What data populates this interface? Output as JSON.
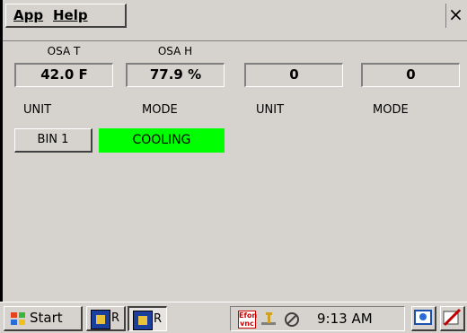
{
  "menu": {
    "app": "App",
    "help": "Help",
    "close": "×"
  },
  "headers": [
    "OSA T",
    "OSA H"
  ],
  "values": [
    "42.0 F",
    "77.9 %",
    "0",
    "0"
  ],
  "labels": [
    "UNIT",
    "MODE",
    "UNIT",
    "MODE"
  ],
  "unit_button": "BIN 1",
  "mode_status": "COOLING",
  "colors": {
    "mode_status_bg": "#00ff00",
    "window_bg": "#d6d3ce"
  },
  "taskbar": {
    "start": "Start",
    "tasks": [
      "R",
      "R"
    ],
    "vnc_icon_text": "Efon vnc",
    "clock": "9:13 AM"
  }
}
